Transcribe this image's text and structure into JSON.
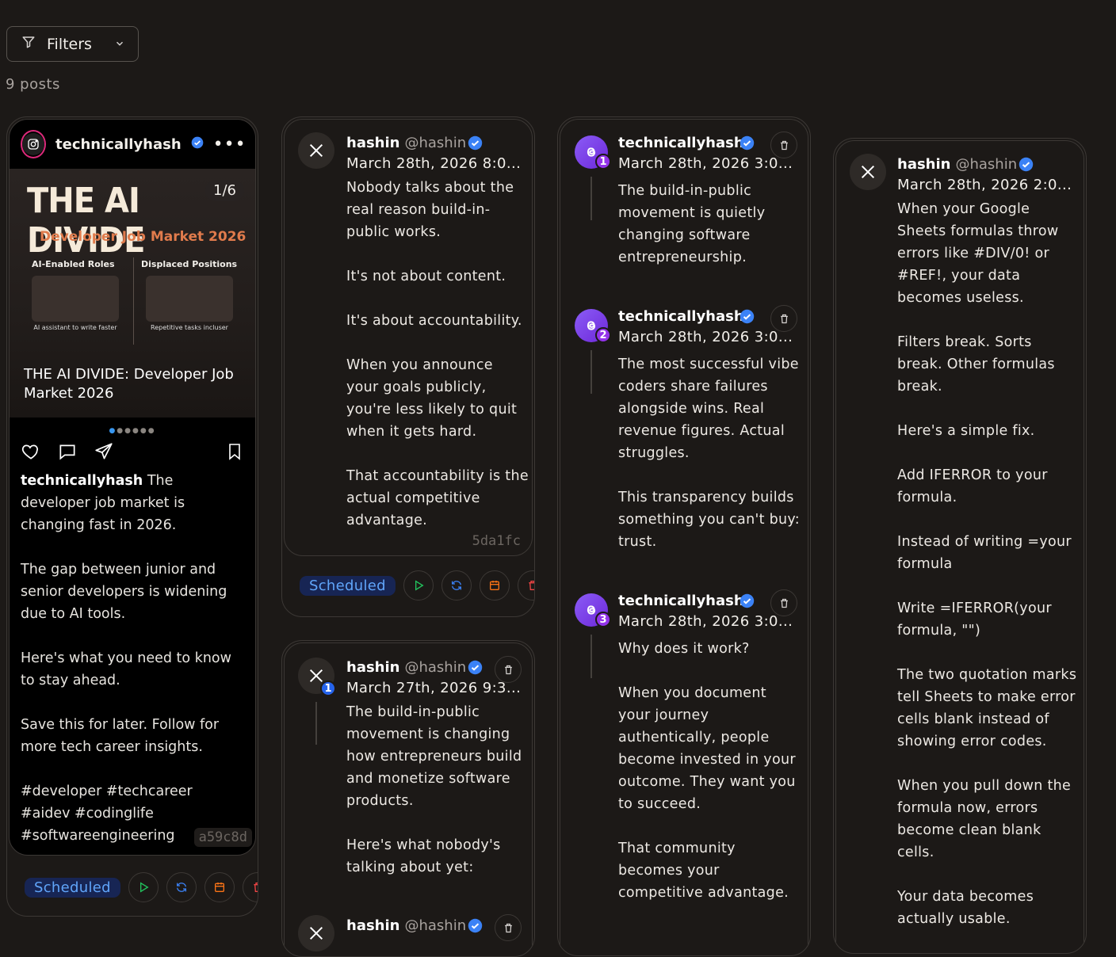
{
  "toolbar": {
    "filters_label": "Filters",
    "posts_count": "9 posts"
  },
  "colors": {
    "background": "#1c1917",
    "accent_blue": "#3b82f6",
    "threads_purple": "#7c3aed",
    "scheduled_text": "#60a5fa"
  },
  "instagram_post": {
    "username": "technicallyhash",
    "image_counter": "1/6",
    "image_title": "THE AI DIVIDE",
    "image_subtitle": "Developer Job Market 2026",
    "image_col1": "AI-Enabled Roles",
    "image_col2": "Displaced Positions",
    "image_cap1": "AI assistant to write faster",
    "image_cap2": "Repetitive tasks incluser",
    "image_overlay": "THE AI DIVIDE: Developer Job Market 2026",
    "caption_user": "technicallyhash",
    "caption_text": " The developer job market is changing fast in 2026.\n\nThe gap between junior and senior developers is widening due to AI tools.\n\nHere's what you need to know to stay ahead.\n\nSave this for later. Follow for more tech career insights.\n\n#developer #techcareer #aidev #codinglife #softwareengineering",
    "hash_id": "a59c8d",
    "status": "Scheduled"
  },
  "tweet1": {
    "name": "hashin",
    "handle": "@hashin",
    "date": "March 28th, 2026 8:0...",
    "body": "Nobody talks about the real reason build-in-public works.\n\nIt's not about content.\n\nIt's about accountability.\n\nWhen you announce your goals publicly, you're less likely to quit when it gets hard.\n\nThat accountability is the actual competitive advantage.",
    "hash_id": "5da1fc",
    "status": "Scheduled"
  },
  "tweet_thread": {
    "name": "hashin",
    "handle": "@hashin",
    "date": "March 27th, 2026 9:3...",
    "number": "1",
    "body": "The build-in-public movement is changing how entrepreneurs build and monetize software products.\n\nHere's what nobody's talking about yet:",
    "next_name": "hashin",
    "next_handle": "@hashin"
  },
  "threads_post": {
    "items": [
      {
        "name": "technicallyhash",
        "date": "March 28th, 2026 3:0...",
        "number": "1",
        "body": "The build-in-public movement is quietly changing software entrepreneurship."
      },
      {
        "name": "technicallyhash",
        "date": "March 28th, 2026 3:0...",
        "number": "2",
        "body": "The most successful vibe coders share failures alongside wins. Real revenue figures. Actual struggles.\n\nThis transparency builds something you can't buy: trust."
      },
      {
        "name": "technicallyhash",
        "date": "March 28th, 2026 3:0...",
        "number": "3",
        "body": "Why does it work?\n\nWhen you document your journey authentically, people become invested in your outcome. They want you to succeed.\n\nThat community becomes your competitive advantage."
      }
    ]
  },
  "tweet4": {
    "name": "hashin",
    "handle": "@hashin",
    "date": "March 28th, 2026 2:0...",
    "body": "When your Google Sheets formulas throw errors like #DIV/0! or #REF!, your data becomes useless.\n\nFilters break. Sorts break. Other formulas break.\n\nHere's a simple fix.\n\nAdd IFERROR to your formula.\n\nInstead of writing =your formula\n\nWrite =IFERROR(your formula, \"\")\n\nThe two quotation marks tell Sheets to make error cells blank instead of showing error codes.\n\nWhen you pull down the formula now, errors become clean blank cells.\n\nYour data becomes actually usable."
  }
}
